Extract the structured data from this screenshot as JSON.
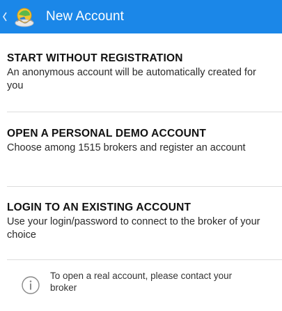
{
  "appbar": {
    "title": "New Account",
    "back_icon": "chevron-left-icon",
    "logo_icon": "app-logo-icon",
    "background": "#1b87e8"
  },
  "options": [
    {
      "title": "START WITHOUT REGISTRATION",
      "description": "An anonymous account will be automatically created for you"
    },
    {
      "title": "OPEN A PERSONAL DEMO ACCOUNT",
      "description": "Choose among 1515 brokers and register an account"
    },
    {
      "title": "LOGIN TO AN EXISTING ACCOUNT",
      "description": "Use your login/password to connect to the broker of your choice"
    }
  ],
  "notice": {
    "icon": "info-icon",
    "text": "To open a real account, please contact your broker"
  }
}
